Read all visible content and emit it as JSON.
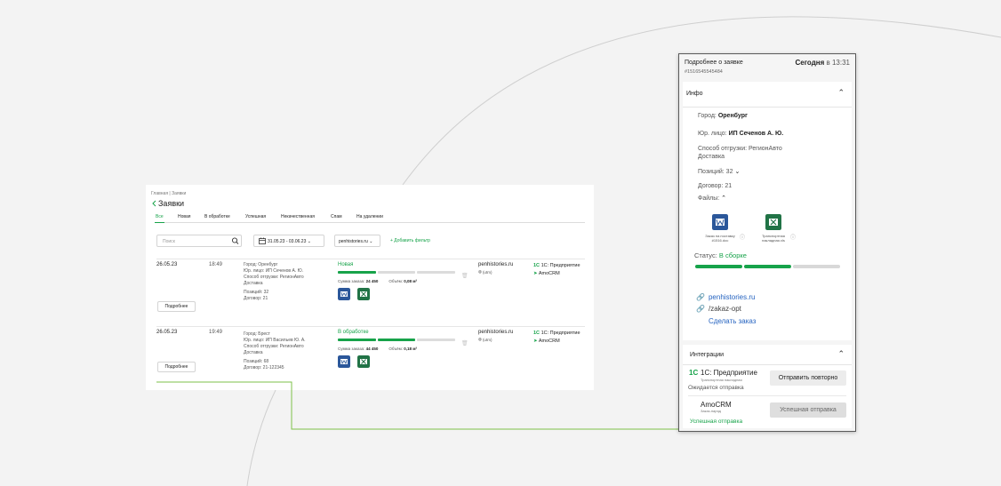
{
  "colors": {
    "accent": "#17a34a",
    "link": "#2563c0",
    "word": "#2b579a",
    "excel": "#217346"
  },
  "breadcrumb": "Главная | Заявки",
  "page_title": "Заявки",
  "tabs": [
    {
      "label": "Все",
      "active": true
    },
    {
      "label": "Новая"
    },
    {
      "label": "В обработке"
    },
    {
      "label": "Успешная"
    },
    {
      "label": "Некачественная"
    },
    {
      "label": "Спам"
    },
    {
      "label": "На удалении"
    }
  ],
  "filters": {
    "search_placeholder": "Поиск",
    "date_range": "31.05.23 - 03.06.23",
    "domain": "penhistories.ru",
    "add_filter": "+ Добавить фильтр"
  },
  "orders": [
    {
      "date": "26.05.23",
      "time": "18:49",
      "city": "Город: Оренбург",
      "entity": "Юр. лицо: ИП Сеченов А. Ю.",
      "shipping": "Способ отгрузки: РегионАвто",
      "shipping2": "Доставка",
      "positions": "Позиций: 32",
      "contract": "Договор: 21",
      "more_label": "Подробнее",
      "status": "Новая",
      "progress_segments_done": 1,
      "sum_label": "Сумма заказа:",
      "sum": "24 450",
      "volume_label": "Объём:",
      "volume": "0,08 м³",
      "domain": "penhistories.ru",
      "utm": "(utm)",
      "int_1c": "1С: Предприятие",
      "int_amo": "AmoCRM"
    },
    {
      "date": "26.05.23",
      "time": "19:49",
      "city": "Город: Брест",
      "entity": "Юр. лицо: ИП Васильев Ю. А.",
      "shipping": "Способ отгрузки: РегионАвто",
      "shipping2": "Доставка",
      "positions": "Позиций: 68",
      "contract": "Договор: 21-122345",
      "more_label": "Подробнее",
      "status": "В обработке",
      "progress_segments_done": 2,
      "sum_label": "Сумма заказа:",
      "sum": "44 450",
      "volume_label": "Объём:",
      "volume": "0,18 м³",
      "domain": "penhistories.ru",
      "utm": "(utm)",
      "int_1c": "1С: Предприятие",
      "int_amo": "AmoCRM"
    }
  ],
  "panel": {
    "title": "Подробнее о заявке",
    "order_id": "#1516545545484",
    "date_strong": "Сегодня",
    "date_rest": " в 13:31",
    "info_header": "Инфо",
    "city_label": "Город: ",
    "city": "Оренбург",
    "entity_label": "Юр. лицо: ",
    "entity": "ИП Сеченов А. Ю.",
    "shipping_line1": "Способ отгрузки: РегионАвто",
    "shipping_line2": "Доставка",
    "positions": "Позиций: 32",
    "contract": "Договор: 21",
    "files_label": "Файлы:",
    "files": [
      {
        "name_line1": "Заказ на поставку",
        "name_line2": "#1516.doc",
        "type": "word"
      },
      {
        "name_line1": "Транспортная",
        "name_line2": "накладная.xls",
        "type": "excel"
      }
    ],
    "status_label": "Статус: ",
    "status": "В сборке",
    "status_segments_done": 2,
    "link_domain": "penhistories.ru",
    "link_path": "/zakaz-opt",
    "make_order": "Сделать заказ",
    "integrations_header": "Интеграции",
    "integrations": [
      {
        "name": "1С: Предприятие",
        "sub": "Транспортная накладная",
        "message": "Ожидается отправка",
        "button": "Отправить повторно"
      },
      {
        "name": "AmoCRM",
        "sub": "Заказ-наряд",
        "message": "Успешная отправка",
        "button": "Успешная отправка"
      }
    ]
  }
}
